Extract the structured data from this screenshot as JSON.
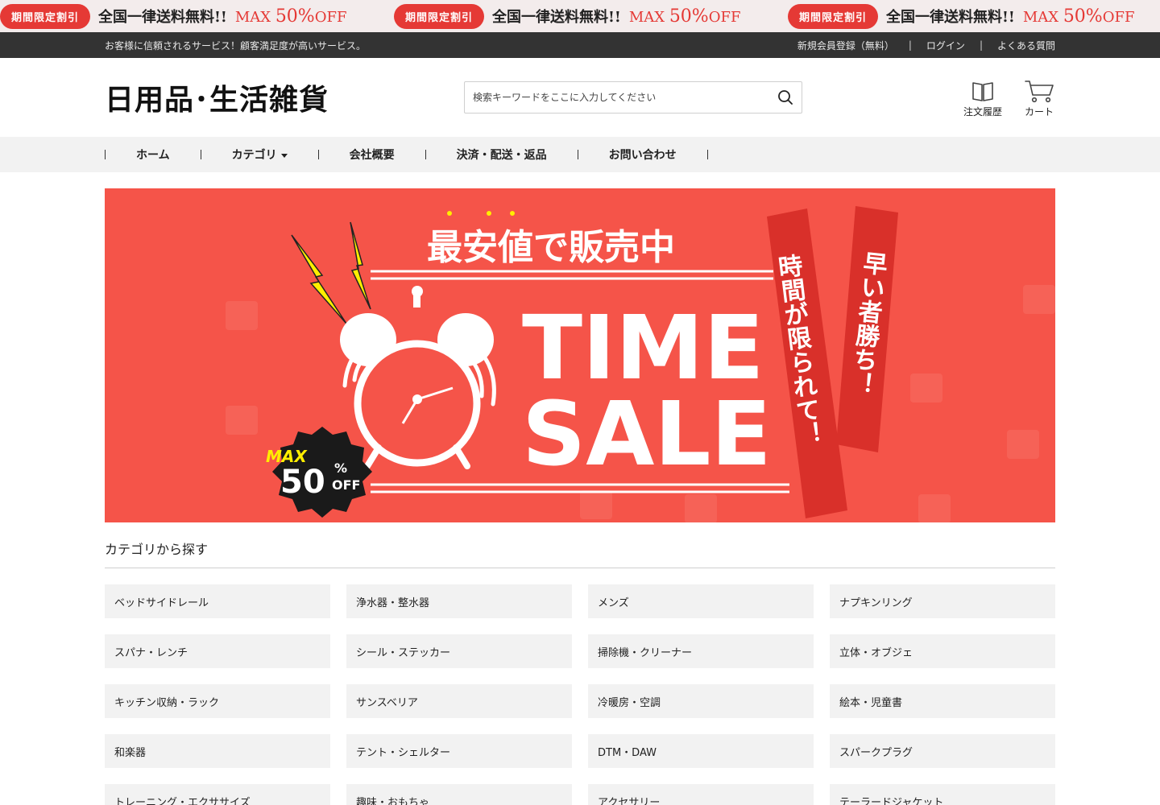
{
  "promo": {
    "badge": "期間限定割引",
    "text": "全国一律送料無料!!",
    "max_label": "MAX",
    "max_value": "50%",
    "max_suffix": "OFF"
  },
  "topbar": {
    "tagline": "お客様に信頼されるサービス！顧客満足度が高いサービス。",
    "links": [
      "新規会員登録（無料）",
      "ログイン",
      "よくある質問"
    ],
    "separator": "|"
  },
  "header": {
    "logo": "日用品･生活雑貨",
    "search_placeholder": "検索キーワードをここに入力してください",
    "order_history_label": "注文履歴",
    "cart_label": "カート"
  },
  "nav": {
    "items": [
      "ホーム",
      "カテゴリ",
      "会社概要",
      "決済・配送・返品",
      "お問い合わせ"
    ]
  },
  "banner": {
    "headline": "最安値で販売中",
    "line1": "TIME",
    "line2": "SALE",
    "ribbon1": "時間が限られて！",
    "ribbon2": "早い者勝ち！",
    "badge_max": "MAX",
    "badge_value": "50",
    "badge_percent": "%",
    "badge_off": "OFF",
    "colors": {
      "background": "#f55449",
      "ribbon": "#d9302a",
      "bolt": "#ffee00"
    }
  },
  "categories": {
    "title": "カテゴリから探す",
    "items": [
      "ベッドサイドレール",
      "浄水器・整水器",
      "メンズ",
      "ナプキンリング",
      "スパナ・レンチ",
      "シール・ステッカー",
      "掃除機・クリーナー",
      "立体・オブジェ",
      "キッチン収納・ラック",
      "サンスベリア",
      "冷暖房・空調",
      "絵本・児童書",
      "和楽器",
      "テント・シェルター",
      "DTM・DAW",
      "スパークプラグ",
      "トレーニング・エクササイズ",
      "趣味・おもちゃ",
      "アクセサリー",
      "テーラードジャケット"
    ]
  }
}
